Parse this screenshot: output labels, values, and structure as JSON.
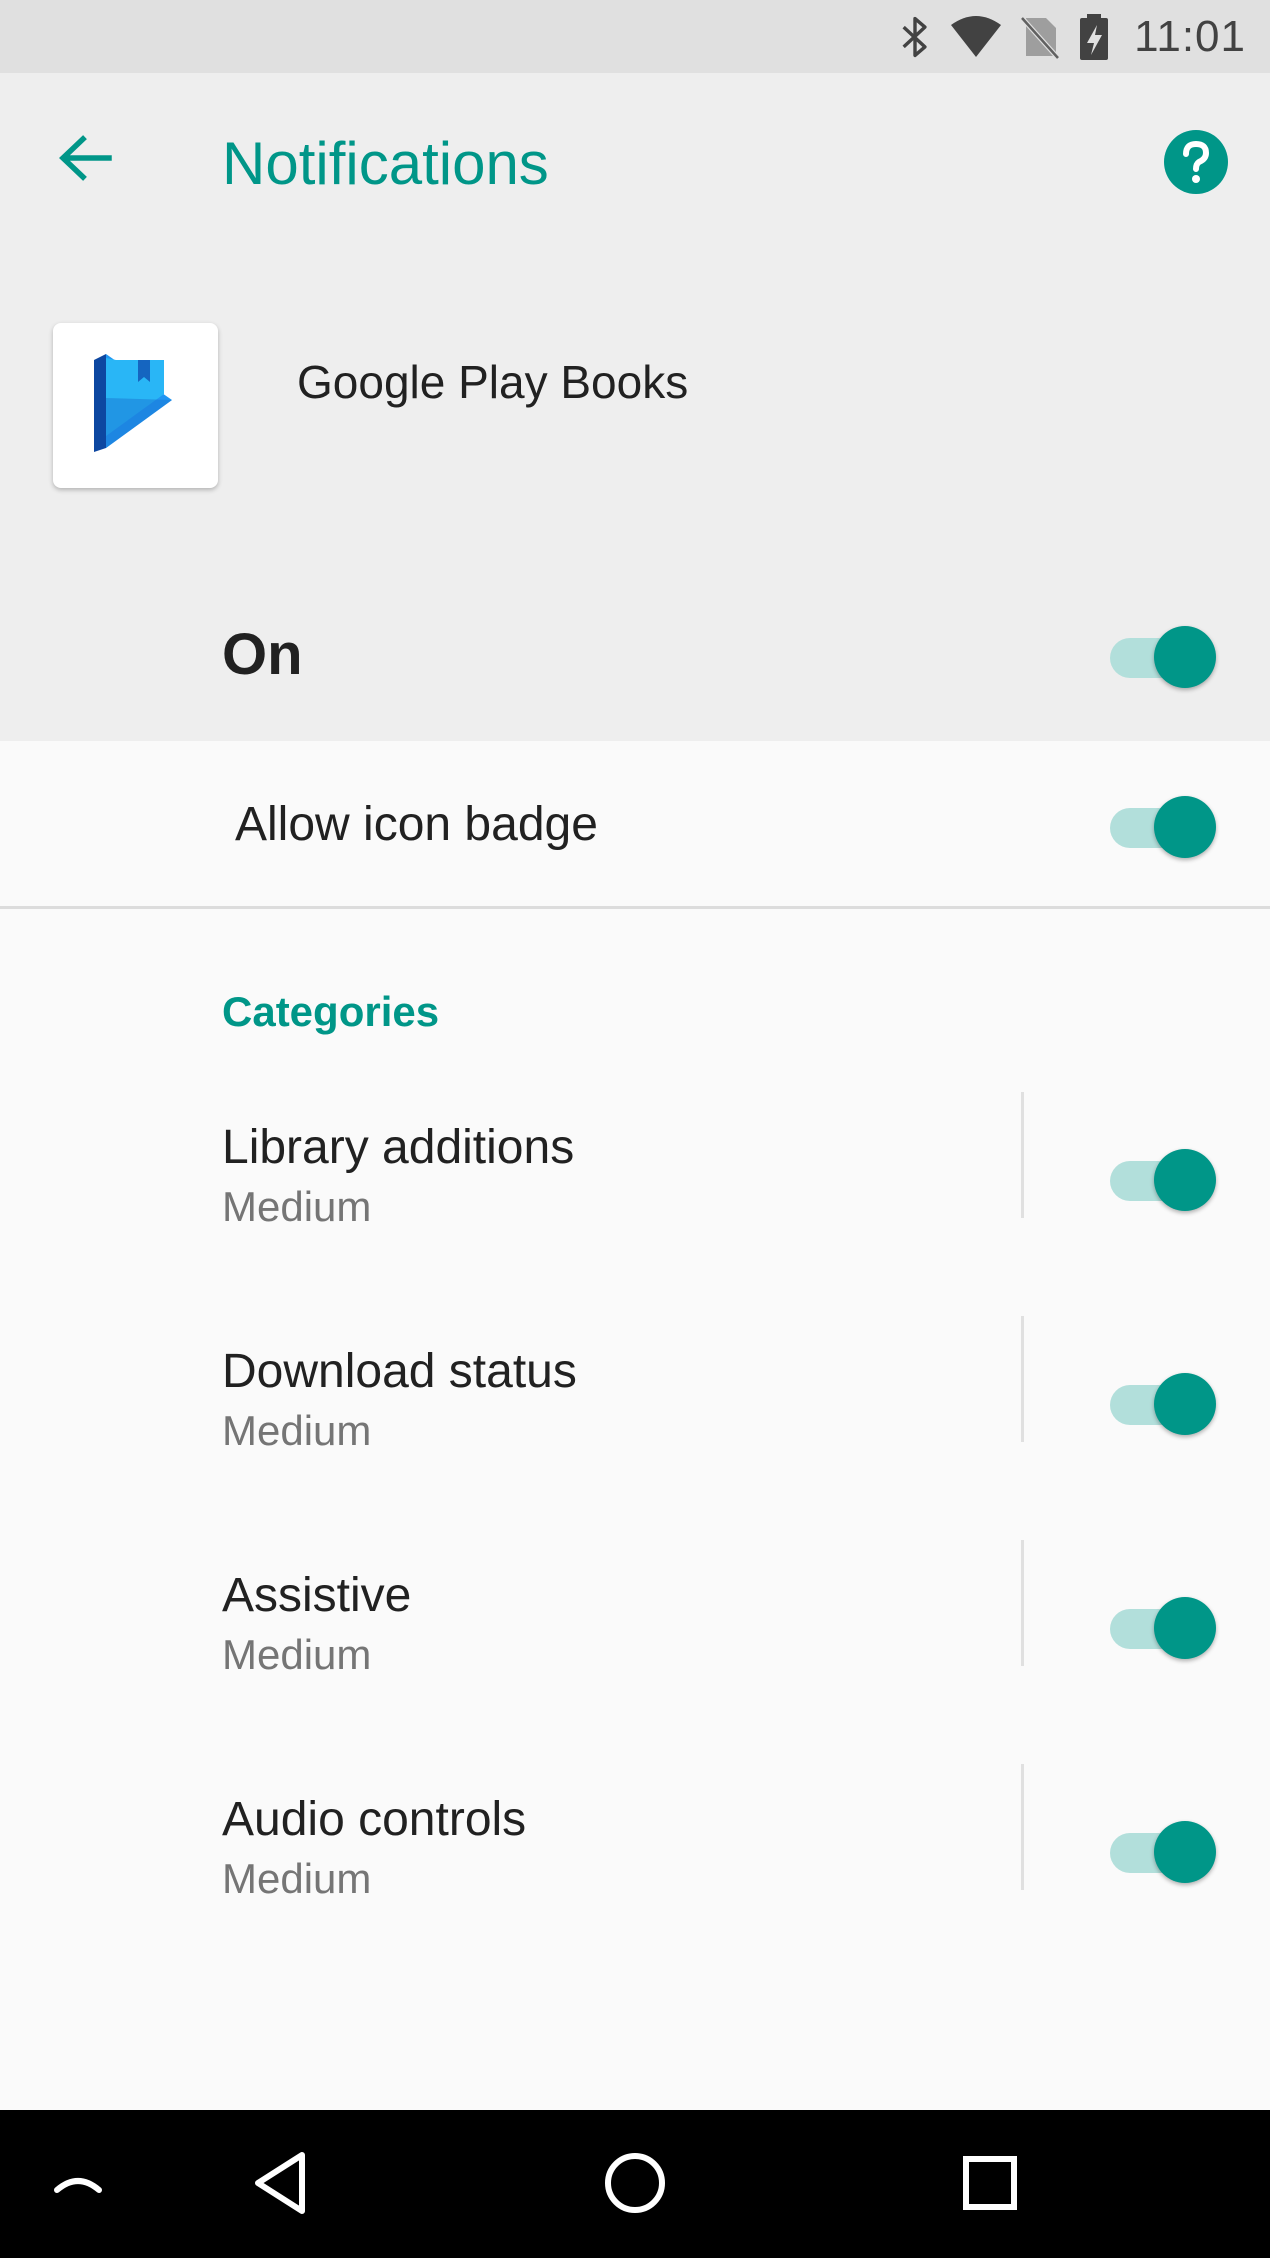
{
  "status_bar": {
    "time": "11:01",
    "icons": [
      "bluetooth-icon",
      "wifi-icon",
      "no-sim-icon",
      "battery-icon"
    ]
  },
  "header": {
    "title": "Notifications",
    "back_icon": "arrow-back-icon",
    "help_icon": "help-icon"
  },
  "app": {
    "name": "Google Play Books",
    "icon": "google-play-books-icon"
  },
  "master": {
    "label": "On",
    "enabled": true
  },
  "badge": {
    "label": "Allow icon badge",
    "enabled": true
  },
  "categories": {
    "header": "Categories",
    "items": [
      {
        "title": "Library additions",
        "importance": "Medium",
        "enabled": true
      },
      {
        "title": "Download status",
        "importance": "Medium",
        "enabled": true
      },
      {
        "title": "Assistive",
        "importance": "Medium",
        "enabled": true
      },
      {
        "title": "Audio controls",
        "importance": "Medium",
        "enabled": true
      }
    ]
  },
  "nav_bar": {
    "icons": [
      "keyboard-dismiss-icon",
      "back-triangle-icon",
      "home-circle-icon",
      "recents-square-icon"
    ]
  },
  "colors": {
    "accent": "#009688",
    "track": "#b2dfdb",
    "header_bg": "#eeeeee",
    "body_bg": "#fafafa"
  }
}
